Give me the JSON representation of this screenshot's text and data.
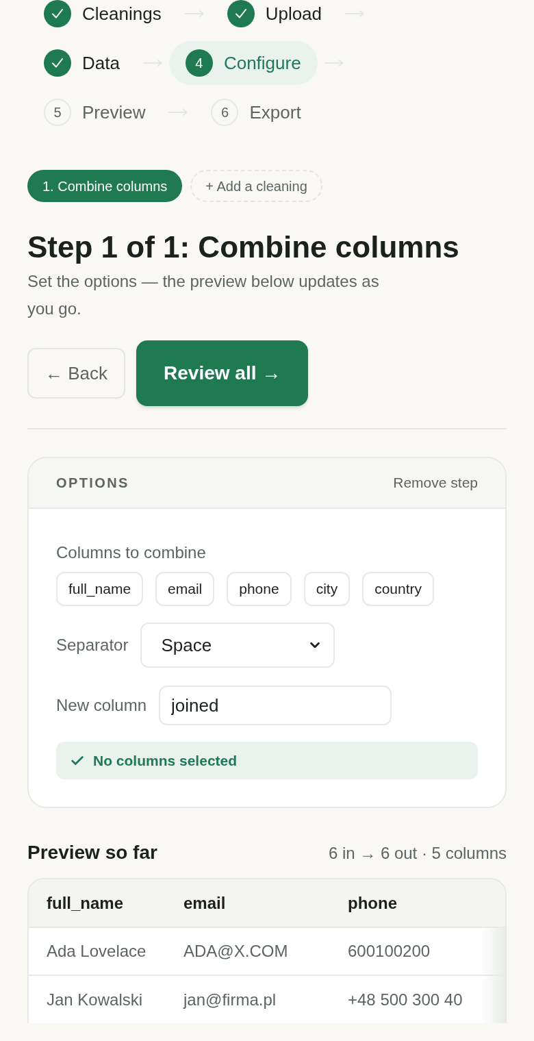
{
  "stepper": {
    "steps": [
      {
        "label": "Cleanings",
        "completed": true,
        "selected": false
      },
      {
        "label": "Upload",
        "completed": true,
        "selected": false
      },
      {
        "label": "Data",
        "completed": true,
        "selected": false
      },
      {
        "number": "4",
        "label": "Configure",
        "completed": false,
        "selected": true
      },
      {
        "number": "5",
        "label": "Preview",
        "completed": false,
        "selected": false
      },
      {
        "number": "6",
        "label": "Export",
        "completed": false,
        "selected": false
      }
    ]
  },
  "cleaning_tabs": {
    "items": [
      {
        "label": "1. Combine columns",
        "selected": true
      }
    ],
    "add_button": "+ Add a cleaning"
  },
  "heading": "Step 1 of 1: Combine columns",
  "subtitle": "Set the options — the preview below updates as you go.",
  "actions": {
    "back": "← Back",
    "primary": "Review all →"
  },
  "options_panel": {
    "title": "OPTIONS",
    "remove": "Remove step",
    "columns_label": "Columns to combine",
    "columns": [
      {
        "label": "full_name",
        "selected": false
      },
      {
        "label": "email",
        "selected": false
      },
      {
        "label": "phone",
        "selected": false
      },
      {
        "label": "city",
        "selected": false
      },
      {
        "label": "country",
        "selected": false
      }
    ],
    "separator": {
      "label": "Separator",
      "value": "Space"
    },
    "new_column": {
      "label": "New column",
      "value": "joined"
    },
    "status": {
      "kind": "success",
      "message": "No columns selected"
    }
  },
  "preview": {
    "title": "Preview so far",
    "summary": "6 in → 6 out · 5 columns",
    "table": {
      "columns": [
        "full_name",
        "email",
        "phone"
      ],
      "rows": [
        [
          "Ada Lovelace",
          "ADA@X.COM",
          "600100200"
        ],
        [
          "Jan Kowalski",
          "jan@firma.pl",
          "+48 500 300 40"
        ]
      ]
    }
  }
}
